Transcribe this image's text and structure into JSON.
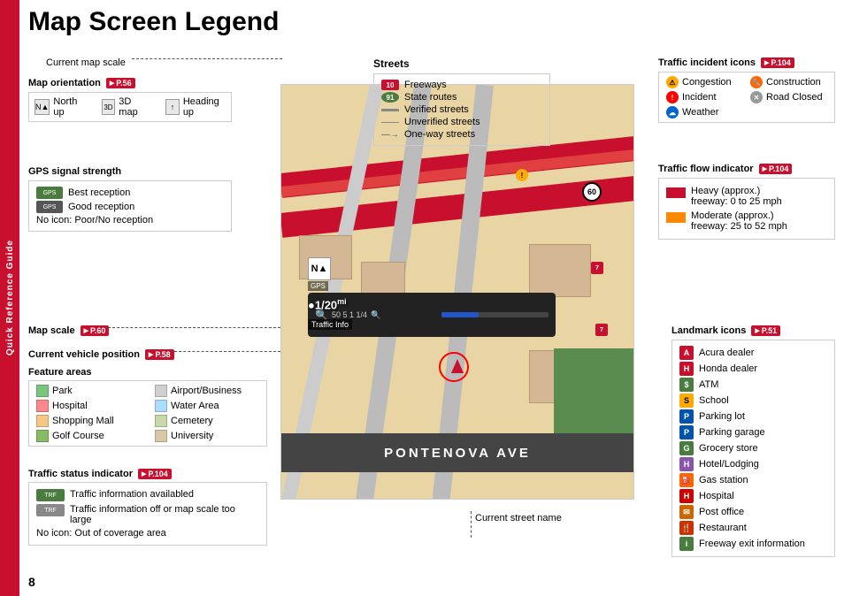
{
  "page": {
    "title": "Map Screen Legend",
    "page_number": "8",
    "sidebar_text": "Quick Reference Guide"
  },
  "current_map_scale": {
    "label": "Current map scale"
  },
  "map_orientation": {
    "label": "Map orientation",
    "ref": "P.56",
    "items": [
      {
        "icon": "N",
        "label": "North up"
      },
      {
        "icon": "3D",
        "label": "3D map"
      },
      {
        "icon": "H",
        "label": "Heading up"
      }
    ]
  },
  "gps_signal": {
    "label": "GPS signal strength",
    "items": [
      {
        "icon": "GPS",
        "label": "Best reception",
        "type": "best"
      },
      {
        "icon": "GPS",
        "label": "Good reception",
        "type": "good"
      },
      {
        "label": "No icon: Poor/No reception",
        "type": "none"
      }
    ]
  },
  "map_scale": {
    "label": "Map scale",
    "ref": "P.60"
  },
  "vehicle_position": {
    "label": "Current vehicle position",
    "ref": "P.58"
  },
  "feature_areas": {
    "label": "Feature areas",
    "items": [
      {
        "label": "Park",
        "color": "#7bc67e"
      },
      {
        "label": "Airport/Business",
        "color": "#d0d0d0"
      },
      {
        "label": "Hospital",
        "color": "#ff8888"
      },
      {
        "label": "Water Area",
        "color": "#aaddff"
      },
      {
        "label": "Shopping Mall",
        "color": "#f5c888"
      },
      {
        "label": "Cemetery",
        "color": "#c8d8a8"
      },
      {
        "label": "Golf Course",
        "color": "#88bb66"
      },
      {
        "label": "University",
        "color": "#d8c8a8"
      }
    ]
  },
  "traffic_status": {
    "label": "Traffic status indicator",
    "ref": "P.104",
    "items": [
      {
        "icon": "TRF",
        "label": "Traffic information availabled",
        "type": "on"
      },
      {
        "icon": "TRF",
        "label": "Traffic information off or map scale too large",
        "type": "off"
      },
      {
        "label": "No icon: Out of coverage area",
        "type": "none"
      }
    ]
  },
  "streets": {
    "label": "Streets",
    "items": [
      {
        "type": "freeway",
        "badge": "10",
        "label": "Freeways"
      },
      {
        "type": "state",
        "badge": "91",
        "label": "State routes"
      },
      {
        "type": "verified",
        "label": "Verified streets"
      },
      {
        "type": "unverified",
        "label": "Unverified streets"
      },
      {
        "type": "oneway",
        "label": "One-way streets"
      }
    ]
  },
  "traffic_incident": {
    "label": "Traffic incident icons",
    "ref": "P.104",
    "items": [
      {
        "label": "Congestion",
        "type": "congestion"
      },
      {
        "label": "Construction",
        "type": "construction"
      },
      {
        "label": "Incident",
        "type": "incident"
      },
      {
        "label": "Road Closed",
        "type": "road_closed"
      },
      {
        "label": "Weather",
        "type": "weather"
      }
    ]
  },
  "traffic_flow": {
    "label": "Traffic flow indicator",
    "ref": "P.104",
    "items": [
      {
        "color": "red",
        "label": "Heavy (approx.)",
        "sublabel": "freeway: 0 to 25 mph"
      },
      {
        "color": "orange",
        "label": "Moderate (approx.)",
        "sublabel": "freeway: 25 to 52 mph"
      }
    ]
  },
  "landmark_icons": {
    "label": "Landmark icons",
    "ref": "P.51",
    "items": [
      {
        "icon": "A",
        "label": "Acura dealer",
        "color": "#c8102e"
      },
      {
        "icon": "H",
        "label": "Honda dealer",
        "color": "#c8102e"
      },
      {
        "icon": "$",
        "label": "ATM",
        "color": "#4a7c3f"
      },
      {
        "icon": "S",
        "label": "School",
        "color": "#ffaa00"
      },
      {
        "icon": "P",
        "label": "Parking lot",
        "color": "#0055aa"
      },
      {
        "icon": "P",
        "label": "Parking garage",
        "color": "#0055aa"
      },
      {
        "icon": "G",
        "label": "Grocery store",
        "color": "#4a7c3f"
      },
      {
        "icon": "H",
        "label": "Hotel/Lodging",
        "color": "#8855aa"
      },
      {
        "icon": "⛽",
        "label": "Gas station",
        "color": "#ff6600"
      },
      {
        "icon": "H",
        "label": "Hospital",
        "color": "#cc0000"
      },
      {
        "icon": "✉",
        "label": "Post office",
        "color": "#cc6600"
      },
      {
        "icon": "🍴",
        "label": "Restaurant",
        "color": "#cc3300"
      },
      {
        "icon": "i",
        "label": "Freeway exit information",
        "color": "#4a7c3f"
      }
    ]
  },
  "current_street": {
    "label": "Current street name"
  },
  "nav_scale": "1/20mi",
  "map_road_name": "PONTENOVA AVE"
}
